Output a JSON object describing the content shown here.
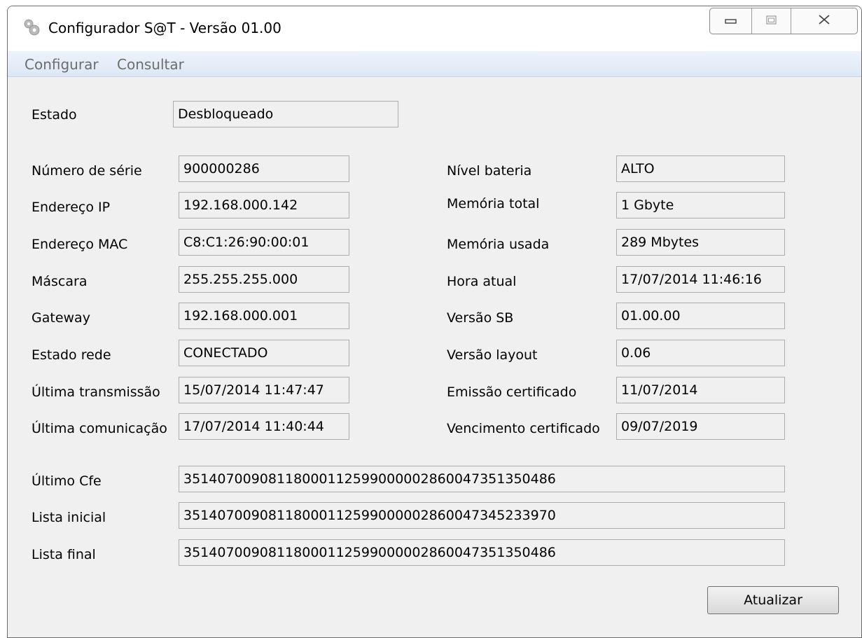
{
  "window": {
    "title": "Configurador S@T - Versão 01.00"
  },
  "menu": {
    "items": [
      "Configurar",
      "Consultar"
    ]
  },
  "icons": {
    "app": "gear-icon",
    "minimize": "minimize-icon",
    "maximize": "maximize-icon",
    "close": "close-icon"
  },
  "status": {
    "label": "Estado",
    "value": "Desbloqueado"
  },
  "left_fields": [
    {
      "label": "Número de série",
      "value": "900000286"
    },
    {
      "label": "Endereço IP",
      "value": "192.168.000.142"
    },
    {
      "label": "Endereço MAC",
      "value": "C8:C1:26:90:00:01"
    },
    {
      "label": "Máscara",
      "value": "255.255.255.000"
    },
    {
      "label": "Gateway",
      "value": "192.168.000.001"
    },
    {
      "label": "Estado rede",
      "value": "CONECTADO"
    },
    {
      "label": "Última transmissão",
      "value": "15/07/2014 11:47:47"
    },
    {
      "label": "Última comunicação",
      "value": "17/07/2014 11:40:44"
    }
  ],
  "right_fields": [
    {
      "label": "Nível bateria",
      "value": "ALTO"
    },
    {
      "label": "Memória total",
      "value": "1 Gbyte"
    },
    {
      "label": "Memória usada",
      "value": "289 Mbytes"
    },
    {
      "label": "Hora atual",
      "value": "17/07/2014 11:46:16"
    },
    {
      "label": "Versão SB",
      "value": "01.00.00"
    },
    {
      "label": "Versão layout",
      "value": "0.06"
    },
    {
      "label": "Emissão certificado",
      "value": "11/07/2014"
    },
    {
      "label": "Vencimento certificado",
      "value": "09/07/2019"
    }
  ],
  "wide_fields": [
    {
      "label": "Último Cfe",
      "value": "35140700908118000112599000002860047351350486"
    },
    {
      "label": "Lista inicial",
      "value": "35140700908118000112599000002860047345233970"
    },
    {
      "label": "Lista final",
      "value": "35140700908118000112599000002860047351350486"
    }
  ],
  "actions": {
    "refresh": "Atualizar"
  }
}
